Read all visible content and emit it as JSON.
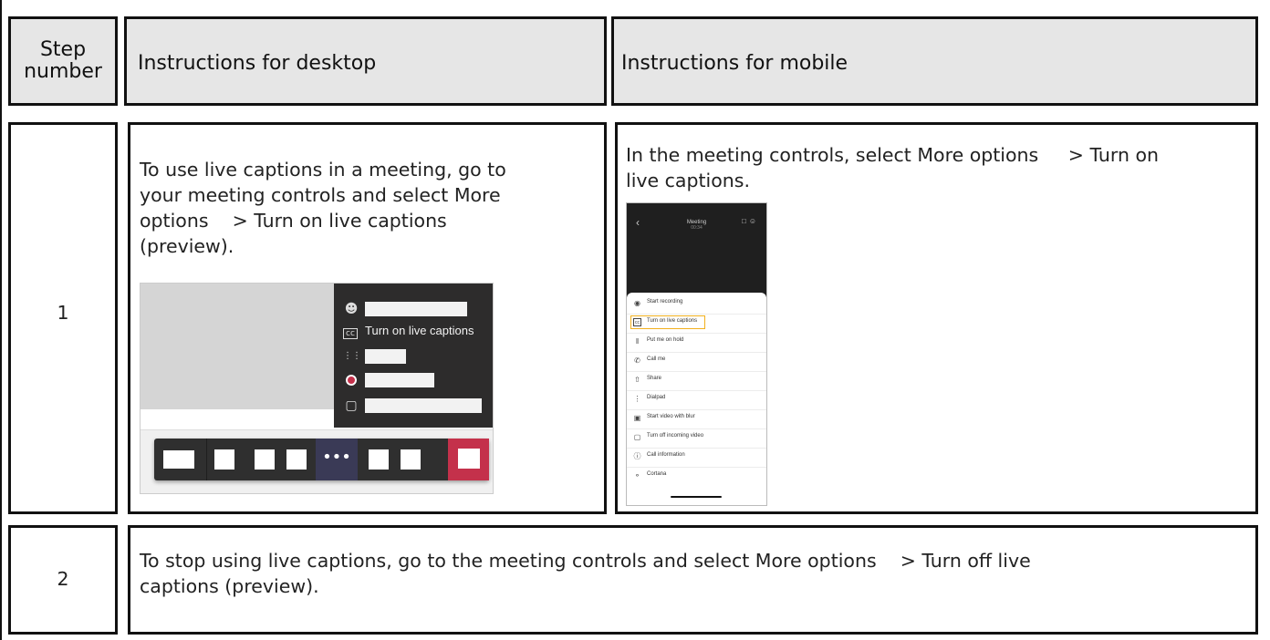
{
  "table": {
    "headers": {
      "step": "Step number",
      "step_line1": "Step",
      "step_line2": "number",
      "desktop": "Instructions for desktop",
      "mobile": "Instructions for mobile"
    },
    "rows": [
      {
        "number": "1",
        "desktop_lines": [
          "To use live captions in a meeting, go to",
          "your meeting controls and select More",
          "options    > Turn on live captions",
          "(preview)."
        ],
        "mobile_lines": [
          "In the meeting controls, select More options     > Turn on",
          "live captions."
        ]
      },
      {
        "number": "2",
        "lines": [
          "To stop using live captions, go to the meeting controls and select More options    > Turn off live",
          "captions (preview)."
        ]
      }
    ]
  },
  "desktop_screenshot": {
    "menu_caption_label": "Turn on live captions",
    "icons": [
      "person-blur-icon",
      "cc-icon",
      "dialpad-icon",
      "record-icon",
      "video-off-icon"
    ],
    "more_glyph": "•••",
    "colors": {
      "menu_bg": "#2d2c2c",
      "toolbar_bg": "#2f2f2f",
      "more_bg": "#3a3a56",
      "hangup": "#c4314b",
      "record": "#c4314b"
    }
  },
  "mobile_screenshot": {
    "title": "Meeting",
    "subtitle": "00:34",
    "menu": [
      {
        "label": "Start recording",
        "icon": "record-icon"
      },
      {
        "label": "Turn on live captions",
        "icon": "cc-icon",
        "highlighted": true
      },
      {
        "label": "Put me on hold",
        "icon": "hold-icon"
      },
      {
        "label": "Call me",
        "icon": "phone-icon"
      },
      {
        "label": "Share",
        "icon": "share-icon"
      },
      {
        "label": "Dialpad",
        "icon": "dialpad-icon"
      },
      {
        "label": "Start video with blur",
        "icon": "blur-icon"
      },
      {
        "label": "Turn off incoming video",
        "icon": "video-off-icon"
      },
      {
        "label": "Call information",
        "icon": "info-icon"
      },
      {
        "label": "Cortana",
        "icon": "microphone-icon"
      }
    ],
    "colors": {
      "highlight": "#f2b01e",
      "top_bg": "#1f1f1f"
    }
  }
}
